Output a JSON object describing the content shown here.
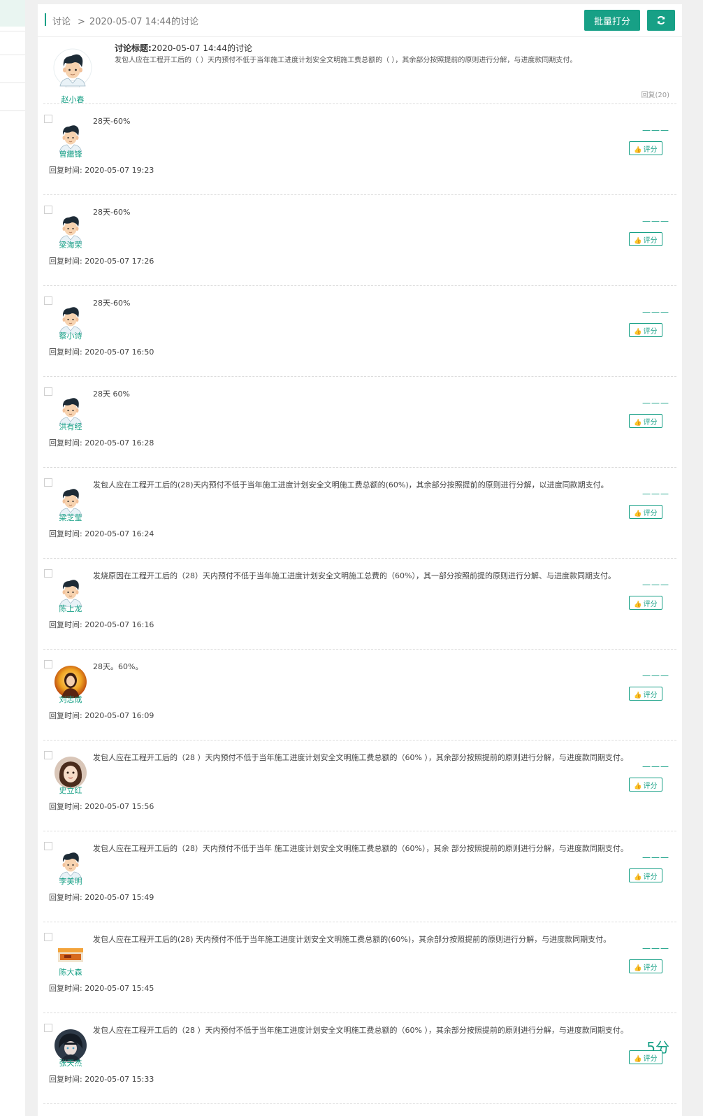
{
  "breadcrumb": {
    "root": "讨论",
    "separator": ">",
    "current": "2020-05-07 14:44的讨论"
  },
  "toolbar": {
    "batch_score_label": "批量打分",
    "refresh_icon": "refresh-icon"
  },
  "topic": {
    "author": "赵小春",
    "title_label": "讨论标题:",
    "title": "2020-05-07 14:44的讨论",
    "content": "发包人应在工程开工后的（ ）天内预付不低于当年施工进度计划安全文明施工费总额的（ ），其余部分按照提前的原则进行分解，与进度款同期支付。",
    "replies_label": "回复(20)"
  },
  "reply_time_label": "回复时间:",
  "rate_label": "评分",
  "accent_color": "#17a086",
  "replies": [
    {
      "name": "曾繼锋",
      "text": "28天-60%",
      "time": "2020-05-07 19:23",
      "score": "———",
      "avatar": "cartoon"
    },
    {
      "name": "梁海荣",
      "text": "28天-60%",
      "time": "2020-05-07 17:26",
      "score": "———",
      "avatar": "cartoon"
    },
    {
      "name": "蔡小诗",
      "text": "28天-60%",
      "time": "2020-05-07 16:50",
      "score": "———",
      "avatar": "cartoon"
    },
    {
      "name": "洪有经",
      "text": "28天 60%",
      "time": "2020-05-07 16:28",
      "score": "———",
      "avatar": "cartoon"
    },
    {
      "name": "梁芝莹",
      "text": "发包人应在工程开工后的(28)天内预付不低于当年施工进度计划安全文明施工费总额的(60%)，其余部分按照提前的原则进行分解，以进度同款期支付。",
      "time": "2020-05-07 16:24",
      "score": "———",
      "avatar": "cartoon"
    },
    {
      "name": "陈上龙",
      "text": "发烧原因在工程开工后的（28）天内预付不低于当年施工进度计划安全文明施工总费的（60%），其一部分按照前提的原则进行分解、与进度款同期支付。",
      "time": "2020-05-07 16:16",
      "score": "———",
      "avatar": "cartoon"
    },
    {
      "name": "刘志成",
      "text": "28天。60%。",
      "time": "2020-05-07 16:09",
      "score": "———",
      "avatar": "photo-gold"
    },
    {
      "name": "史立红",
      "text": "发包人应在工程开工后的（28 ）天内预付不低于当年施工进度计划安全文明施工费总额的（60% ），其余部分按照提前的原则进行分解，与进度款同期支付。",
      "time": "2020-05-07 15:56",
      "score": "———",
      "avatar": "photo-girl"
    },
    {
      "name": "李美明",
      "text": "发包人应在工程开工后的（28）天内预付不低于当年 施工进度计划安全文明施工费总额的（60%），其余 部分按照提前的原则进行分解，与进度款同期支付。",
      "time": "2020-05-07 15:49",
      "score": "———",
      "avatar": "cartoon"
    },
    {
      "name": "陈大森",
      "text": "发包人应在工程开工后的(28) 天内预付不低于当年施工进度计划安全文明施工费总额的(60%)，其余部分按照提前的原则进行分解，与进度款同期支付。",
      "time": "2020-05-07 15:45",
      "score": "———",
      "avatar": "photo-food"
    },
    {
      "name": "张天杰",
      "text": "发包人应在工程开工后的（28 ）天内预付不低于当年施工进度计划安全文明施工费总额的（60% ），其余部分按照提前的原则进行分解，与进度款同期支付。",
      "time": "2020-05-07 15:33",
      "score": "5分",
      "avatar": "photo-anime"
    }
  ]
}
